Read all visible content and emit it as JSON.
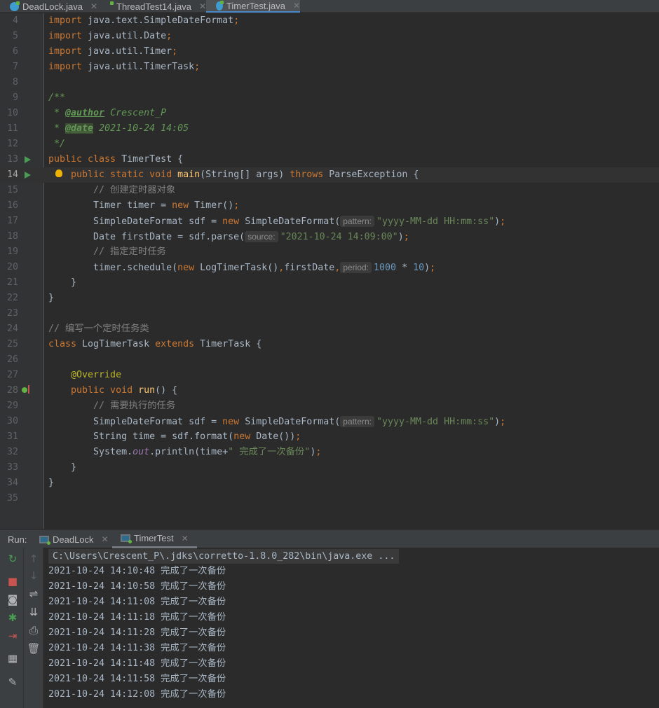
{
  "tabs": [
    {
      "label": "DeadLock.java",
      "active": false
    },
    {
      "label": "ThreadTest14.java",
      "active": false
    },
    {
      "label": "TimerTest.java",
      "active": true
    }
  ],
  "editor": {
    "current_line": 14,
    "lines": [
      {
        "n": 4,
        "tk": [
          [
            "k",
            "import "
          ],
          [
            "p",
            "java.text.SimpleDateFormat"
          ],
          [
            "k",
            ";"
          ]
        ]
      },
      {
        "n": 5,
        "tk": [
          [
            "k",
            "import "
          ],
          [
            "p",
            "java.util.Date"
          ],
          [
            "k",
            ";"
          ]
        ]
      },
      {
        "n": 6,
        "tk": [
          [
            "k",
            "import "
          ],
          [
            "p",
            "java.util.Timer"
          ],
          [
            "k",
            ";"
          ]
        ]
      },
      {
        "n": 7,
        "tk": [
          [
            "k",
            "import "
          ],
          [
            "p",
            "java.util.TimerTask"
          ],
          [
            "k",
            ";"
          ]
        ]
      },
      {
        "n": 8,
        "tk": []
      },
      {
        "n": 9,
        "tk": [
          [
            "d",
            "/**"
          ]
        ]
      },
      {
        "n": 10,
        "tk": [
          [
            "d",
            " * "
          ],
          [
            "t",
            "@author"
          ],
          [
            "d",
            " Crescent_P"
          ]
        ]
      },
      {
        "n": 11,
        "tk": [
          [
            "d",
            " * "
          ],
          [
            "t hl",
            "@date"
          ],
          [
            "d",
            " 2021-10-24 14:05"
          ]
        ]
      },
      {
        "n": 12,
        "tk": [
          [
            "d",
            " */"
          ]
        ]
      },
      {
        "n": 13,
        "tk": [
          [
            "k",
            "public class "
          ],
          [
            "p",
            "TimerTest {"
          ]
        ],
        "icon": "run"
      },
      {
        "n": 14,
        "tk": [
          [
            "k",
            "    public static void "
          ],
          [
            "m",
            "main"
          ],
          [
            "p",
            "(String[] args) "
          ],
          [
            "k",
            "throws "
          ],
          [
            "p",
            "ParseException {"
          ]
        ],
        "icon": "run",
        "bulb": true
      },
      {
        "n": 15,
        "tk": [
          [
            "c",
            "        // 创建定时器对象"
          ]
        ]
      },
      {
        "n": 16,
        "tk": [
          [
            "p",
            "        Timer timer = "
          ],
          [
            "k",
            "new "
          ],
          [
            "p",
            "Timer()"
          ],
          [
            "k",
            ";"
          ]
        ]
      },
      {
        "n": 17,
        "tk": [
          [
            "p",
            "        SimpleDateFormat sdf = "
          ],
          [
            "k",
            "new "
          ],
          [
            "p",
            "SimpleDateFormat("
          ],
          [
            "h",
            "pattern:"
          ],
          [
            "s",
            "\"yyyy-MM-dd HH:mm:ss\""
          ],
          [
            "p",
            ")"
          ],
          [
            "k",
            ";"
          ]
        ]
      },
      {
        "n": 18,
        "tk": [
          [
            "p",
            "        Date firstDate = sdf.parse("
          ],
          [
            "h",
            "source:"
          ],
          [
            "s",
            "\"2021-10-24 14:09:00\""
          ],
          [
            "p",
            ")"
          ],
          [
            "k",
            ";"
          ]
        ]
      },
      {
        "n": 19,
        "tk": [
          [
            "c",
            "        // 指定定时任务"
          ]
        ]
      },
      {
        "n": 20,
        "tk": [
          [
            "p",
            "        timer.schedule("
          ],
          [
            "k",
            "new "
          ],
          [
            "p",
            "LogTimerTask()"
          ],
          [
            "k",
            ","
          ],
          [
            "p",
            "firstDate"
          ],
          [
            "k",
            ","
          ],
          [
            "h",
            "period:"
          ],
          [
            "n",
            "1000 "
          ],
          [
            "p",
            "* "
          ],
          [
            "n",
            "10"
          ],
          [
            "p",
            ")"
          ],
          [
            "k",
            ";"
          ]
        ]
      },
      {
        "n": 21,
        "tk": [
          [
            "p",
            "    }"
          ]
        ]
      },
      {
        "n": 22,
        "tk": [
          [
            "p",
            "}"
          ]
        ]
      },
      {
        "n": 23,
        "tk": []
      },
      {
        "n": 24,
        "tk": [
          [
            "c",
            "// 编写一个定时任务类"
          ]
        ]
      },
      {
        "n": 25,
        "tk": [
          [
            "k",
            "class "
          ],
          [
            "p",
            "LogTimerTask "
          ],
          [
            "k",
            "extends "
          ],
          [
            "p",
            "TimerTask {"
          ]
        ]
      },
      {
        "n": 26,
        "tk": []
      },
      {
        "n": 27,
        "tk": [
          [
            "a",
            "    @Override"
          ]
        ]
      },
      {
        "n": 28,
        "tk": [
          [
            "k",
            "    public void "
          ],
          [
            "m",
            "run"
          ],
          [
            "p",
            "() {"
          ]
        ],
        "icon": "override"
      },
      {
        "n": 29,
        "tk": [
          [
            "c",
            "        // 需要执行的任务"
          ]
        ]
      },
      {
        "n": 30,
        "tk": [
          [
            "p",
            "        SimpleDateFormat sdf = "
          ],
          [
            "k",
            "new "
          ],
          [
            "p",
            "SimpleDateFormat("
          ],
          [
            "h",
            "pattern:"
          ],
          [
            "s",
            "\"yyyy-MM-dd HH:mm:ss\""
          ],
          [
            "p",
            ")"
          ],
          [
            "k",
            ";"
          ]
        ]
      },
      {
        "n": 31,
        "tk": [
          [
            "p",
            "        String time = sdf.format("
          ],
          [
            "k",
            "new "
          ],
          [
            "p",
            "Date())"
          ],
          [
            "k",
            ";"
          ]
        ]
      },
      {
        "n": 32,
        "tk": [
          [
            "p",
            "        System."
          ],
          [
            "f",
            "out"
          ],
          [
            "p",
            ".println(time+"
          ],
          [
            "s",
            "\" 完成了一次备份\""
          ],
          [
            "p",
            ")"
          ],
          [
            "k",
            ";"
          ]
        ]
      },
      {
        "n": 33,
        "tk": [
          [
            "p",
            "    }"
          ]
        ]
      },
      {
        "n": 34,
        "tk": [
          [
            "p",
            "}"
          ]
        ]
      },
      {
        "n": 35,
        "tk": []
      }
    ]
  },
  "run": {
    "label": "Run:",
    "tabs": [
      {
        "label": "DeadLock",
        "active": false
      },
      {
        "label": "TimerTest",
        "active": true
      }
    ],
    "command": "C:\\Users\\Crescent_P\\.jdks\\corretto-1.8.0_282\\bin\\java.exe ...",
    "output": [
      "2021-10-24 14:10:48 完成了一次备份",
      "2021-10-24 14:10:58 完成了一次备份",
      "2021-10-24 14:11:08 完成了一次备份",
      "2021-10-24 14:11:18 完成了一次备份",
      "2021-10-24 14:11:28 完成了一次备份",
      "2021-10-24 14:11:38 完成了一次备份",
      "2021-10-24 14:11:48 完成了一次备份",
      "2021-10-24 14:11:58 完成了一次备份",
      "2021-10-24 14:12:08 完成了一次备份"
    ],
    "tools_left": [
      {
        "name": "rerun-icon",
        "g": "↻",
        "color": "#499c54"
      },
      {
        "name": "stop-icon",
        "g": "■",
        "color": "#c75450"
      },
      {
        "name": "camera-icon",
        "g": "◙",
        "color": "#afb1b3"
      },
      {
        "name": "debug-icon",
        "g": "✱",
        "color": "#499c54"
      },
      {
        "name": "exit-icon",
        "g": "⇥",
        "color": "#c75450"
      },
      {
        "name": "layout-icon",
        "g": "▦",
        "color": "#afb1b3"
      },
      {
        "name": "pin-icon",
        "g": "✎",
        "color": "#afb1b3"
      }
    ],
    "tools_right": [
      {
        "name": "up-arrow-icon",
        "g": "↑",
        "color": "#5d6164"
      },
      {
        "name": "down-arrow-icon",
        "g": "↓",
        "color": "#5d6164"
      },
      {
        "name": "soft-wrap-icon",
        "g": "⇌",
        "color": "#afb1b3"
      },
      {
        "name": "scroll-to-end-icon",
        "g": "⇊",
        "color": "#afb1b3"
      },
      {
        "name": "print-icon",
        "g": "⎙",
        "color": "#afb1b3"
      },
      {
        "name": "trash-icon",
        "g": "🗑",
        "color": "#afb1b3"
      }
    ]
  }
}
